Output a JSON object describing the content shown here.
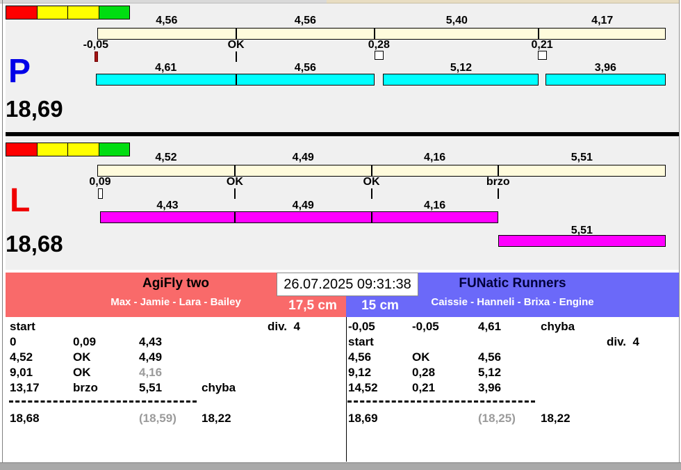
{
  "timestamp": "26.07.2025 09:31:38",
  "traffic_light_colors": [
    "#ff0000",
    "#ffff00",
    "#ffff00",
    "#00dd11"
  ],
  "panels": [
    {
      "lane": "P",
      "letter": "P",
      "letter_color": "#0000e8",
      "total_label": "18,69",
      "total_seconds": 18.69,
      "bar_fill": "#00ffff",
      "split_bar_fill": "#fffbdc",
      "split_bar_segments": [
        {
          "label": "4,56",
          "t0": 0,
          "t1": 4.56
        },
        {
          "label": "4,56",
          "t0": 4.56,
          "t1": 9.12
        },
        {
          "label": "5,40",
          "t0": 9.12,
          "t1": 14.52
        },
        {
          "label": "4,17",
          "t0": 14.52,
          "t1": 18.69
        }
      ],
      "markers": [
        {
          "label": "-0,05",
          "t": -0.05,
          "type": "red-bar"
        },
        {
          "label": "OK",
          "t": 4.56,
          "type": "tick"
        },
        {
          "label": "0,28",
          "t": 9.26,
          "type": "square"
        },
        {
          "label": "0,21",
          "t": 14.625,
          "type": "square"
        }
      ],
      "dog_bar_segments": [
        {
          "label": "4,61",
          "t0": -0.05,
          "t1": 4.56
        },
        {
          "label": "4,56",
          "t0": 4.56,
          "t1": 9.12
        },
        {
          "label": "5,12",
          "t0": 9.4,
          "t1": 14.52
        },
        {
          "label": "3,96",
          "t0": 14.73,
          "t1": 18.69
        }
      ]
    },
    {
      "lane": "L",
      "letter": "L",
      "letter_color": "#f00000",
      "total_label": "18,68",
      "total_seconds": 18.68,
      "bar_fill": "#ff00ff",
      "split_bar_fill": "#fffbdc",
      "split_bar_segments": [
        {
          "label": "4,52",
          "t0": 0,
          "t1": 4.52
        },
        {
          "label": "4,49",
          "t0": 4.52,
          "t1": 9.01
        },
        {
          "label": "4,16",
          "t0": 9.01,
          "t1": 13.17
        },
        {
          "label": "5,51",
          "t0": 13.17,
          "t1": 18.68
        }
      ],
      "markers": [
        {
          "label": "0,09",
          "t": 0.09,
          "type": "white-bar"
        },
        {
          "label": "OK",
          "t": 4.52,
          "type": "tick"
        },
        {
          "label": "OK",
          "t": 9.01,
          "type": "tick"
        },
        {
          "label": "brzo",
          "t": 13.17,
          "type": "tick"
        }
      ],
      "dog_bar_segments": [
        {
          "label": "4,43",
          "t0": 0.09,
          "t1": 4.52
        },
        {
          "label": "4,49",
          "t0": 4.52,
          "t1": 9.01
        },
        {
          "label": "4,16",
          "t0": 9.01,
          "t1": 13.17
        },
        {
          "label": "5,51",
          "t0": 13.17,
          "t1": 18.68,
          "lower": true
        }
      ]
    }
  ],
  "teams": {
    "left": {
      "name": "AgiFly two",
      "name_color": "#000000",
      "members": "Max - Jamie - Lara - Bailey",
      "jump_height": "17,5 cm",
      "bg": "#f96a6a",
      "table": {
        "rows": [
          [
            "start",
            "",
            "",
            "",
            "div.  4"
          ],
          [
            "0",
            "0,09",
            "4,43",
            "",
            ""
          ],
          [
            "4,52",
            "OK",
            "4,49",
            "",
            ""
          ],
          [
            "9,01",
            "OK",
            {
              "text": "4,16",
              "muted": true
            },
            "",
            ""
          ],
          [
            "13,17",
            "brzo",
            "5,51",
            "chyba",
            ""
          ]
        ],
        "totals": [
          "18,68",
          "",
          {
            "text": "(18,59)",
            "muted": true
          },
          "18,22",
          ""
        ]
      }
    },
    "right": {
      "name": "FUNatic Runners",
      "name_color": "#00003c",
      "members": "Caissie - Hanneli - Brixa - Engine",
      "jump_height": "15 cm",
      "bg": "#6b69f9",
      "table": {
        "rows": [
          [
            "-0,05",
            "-0,05",
            "4,61",
            "chyba",
            ""
          ],
          [
            "start",
            "",
            "",
            "",
            "div.  4"
          ],
          [
            "4,56",
            "OK",
            "4,56",
            "",
            ""
          ],
          [
            "9,12",
            "0,28",
            "5,12",
            "",
            ""
          ],
          [
            "14,52",
            "0,21",
            "3,96",
            "",
            ""
          ]
        ],
        "totals": [
          "18,69",
          "",
          {
            "text": "(18,25)",
            "muted": true
          },
          "18,22",
          ""
        ]
      }
    }
  }
}
